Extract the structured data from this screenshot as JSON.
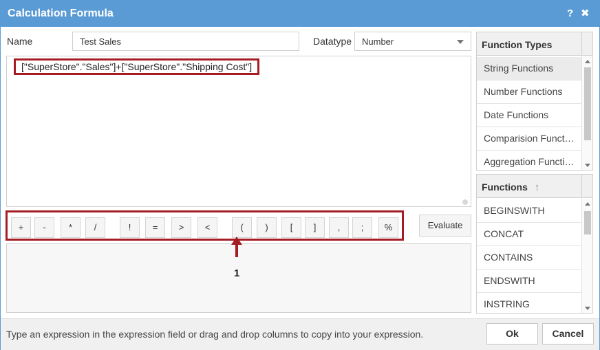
{
  "dialog": {
    "title": "Calculation Formula",
    "help_label": "?",
    "close_label": "✖"
  },
  "form": {
    "name_label": "Name",
    "name_value": "Test Sales",
    "datatype_label": "Datatype",
    "datatype_value": "Number"
  },
  "expression": {
    "value": "[\"SuperStore\".\"Sales\"]+[\"SuperStore\".\"Shipping Cost\"]"
  },
  "operators": [
    "+",
    "-",
    "*",
    "/",
    "!",
    "=",
    ">",
    "<",
    "(",
    ")",
    "[",
    "]",
    ",",
    ";",
    "%"
  ],
  "evaluate_label": "Evaluate",
  "callout": {
    "number": "1"
  },
  "function_types": {
    "header": "Function Types",
    "items": [
      "String Functions",
      "Number Functions",
      "Date Functions",
      "Comparision Functions",
      "Aggregation Functions"
    ],
    "selected": "String Functions"
  },
  "functions": {
    "header": "Functions",
    "sort_icon": "sort-ascending-icon",
    "items": [
      "BEGINSWITH",
      "CONCAT",
      "CONTAINS",
      "ENDSWITH",
      "INSTRING"
    ]
  },
  "footer": {
    "hint": "Type an expression in the expression field or drag and drop columns to copy into your expression.",
    "ok_label": "Ok",
    "cancel_label": "Cancel"
  },
  "colors": {
    "title_bar": "#5b9bd5",
    "highlight_border": "#a51c24"
  }
}
